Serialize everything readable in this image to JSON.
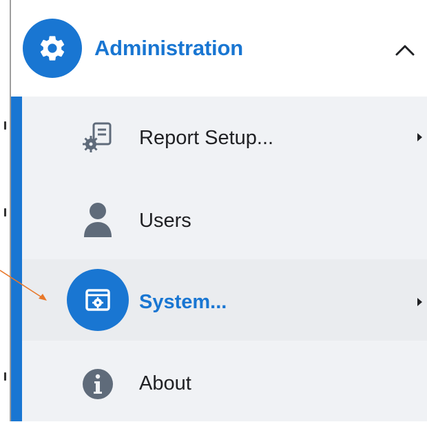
{
  "menu": {
    "header": {
      "title": "Administration",
      "icon": "gear-icon",
      "chevron": "chevron-up-icon",
      "expanded": true
    },
    "items": [
      {
        "label": "Report Setup...",
        "icon": "report-settings-icon",
        "has_submenu": true,
        "selected": false
      },
      {
        "label": "Users",
        "icon": "user-icon",
        "has_submenu": false,
        "selected": false
      },
      {
        "label": "System...",
        "icon": "system-settings-icon",
        "has_submenu": true,
        "selected": true
      },
      {
        "label": "About",
        "icon": "info-icon",
        "has_submenu": false,
        "selected": false
      }
    ]
  },
  "colors": {
    "accent": "#1976d2",
    "submenu_bg": "#f0f2f5",
    "icon_gray": "#5f6b7a",
    "annotation_arrow": "#e8782a"
  }
}
